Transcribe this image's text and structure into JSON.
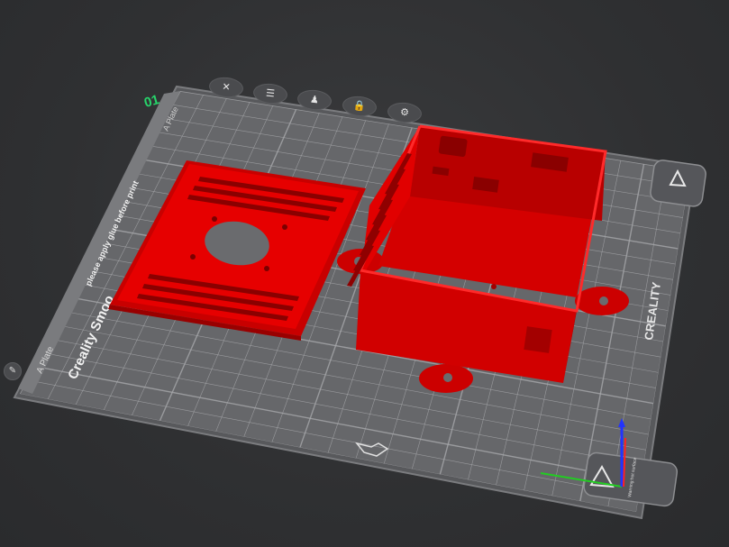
{
  "plate": {
    "number": "01",
    "tab_label": "A Plate",
    "tab_label_side": "A Plate",
    "brand_vertical": "Creality Smoo",
    "glue_notice": "please apply glue before print",
    "brand_right": "CREALITY",
    "warning_label": "Warning:hot surface"
  },
  "toolbar": {
    "icons": [
      "close-icon",
      "arrange-icon",
      "auto-orient-icon",
      "lock-icon",
      "settings-icon"
    ],
    "glyphs": [
      "✕",
      "☰",
      "♟",
      "🔒",
      "⚙"
    ]
  },
  "colors": {
    "background": "#2e2f31",
    "bed": "#6b6c6f",
    "bed_frame": "#8a8b8e",
    "grid": "#a7a8ab",
    "model": "#e60000",
    "model_dark": "#b30000",
    "axis_x": "#22cc22",
    "axis_y": "#ff2222",
    "axis_z": "#2233ff",
    "plate_number": "#27d36a"
  },
  "side_icons": {
    "edit": "pencil-icon",
    "edit_glyph": "✎"
  }
}
